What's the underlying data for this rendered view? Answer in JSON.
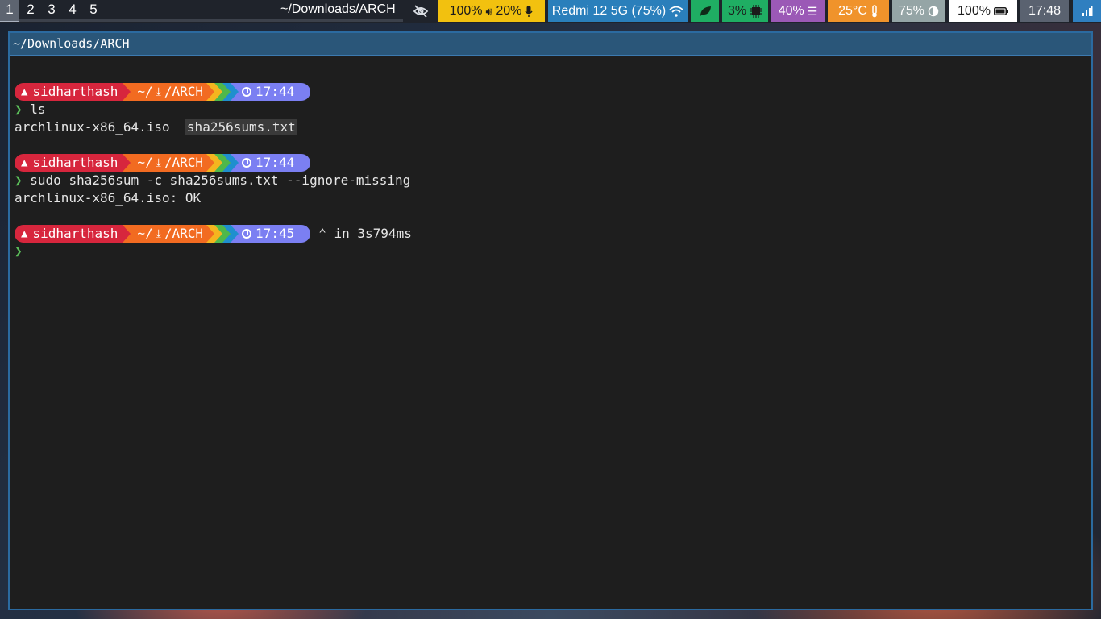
{
  "topbar": {
    "workspaces": [
      "1",
      "2",
      "3",
      "4",
      "5"
    ],
    "active_workspace": "1",
    "window_title": "~/Downloads/ARCH",
    "modules": {
      "idle_icon": "eye-slash-icon",
      "volume": "100%",
      "volume_icon": "speaker-icon",
      "mic": "20%",
      "mic_icon": "microphone-icon",
      "network": "Redmi 12 5G (75%)",
      "network_icon": "wifi-icon",
      "leaf_icon": "leaf-icon",
      "cpu": "3%",
      "cpu_icon": "chip-icon",
      "memory": "40%",
      "memory_icon": "bars-icon",
      "temperature": "25°C",
      "temperature_icon": "thermometer-icon",
      "brightness": "75%",
      "brightness_icon": "half-circle-icon",
      "battery": "100%",
      "battery_icon": "battery-icon",
      "clock": "17:48",
      "tray_icon": "signal-icon"
    }
  },
  "terminal": {
    "title": "~/Downloads/ARCH",
    "prompts": [
      {
        "user": "sidharthash",
        "path_home": "~/",
        "path_dir": "/ARCH",
        "time": "17:44",
        "command": "ls",
        "duration": ""
      },
      {
        "user": "sidharthash",
        "path_home": "~/",
        "path_dir": "/ARCH",
        "time": "17:44",
        "command": "sudo sha256sum -c sha256sums.txt --ignore-missing",
        "duration": ""
      },
      {
        "user": "sidharthash",
        "path_home": "~/",
        "path_dir": "/ARCH",
        "time": "17:45",
        "command": "",
        "duration": "in 3s794ms"
      }
    ],
    "ls_output": {
      "file1": "archlinux-x86_64.iso",
      "file2": "sha256sums.txt"
    },
    "check_output": "archlinux-x86_64.iso: OK",
    "prompt_char": "❯"
  },
  "colors": {
    "user_segment": "#d7263d",
    "path_segment": "#f26b21",
    "time_segment": "#7b7ff2",
    "terminal_bg": "#1e1e1e",
    "border": "#2b6aa0"
  }
}
